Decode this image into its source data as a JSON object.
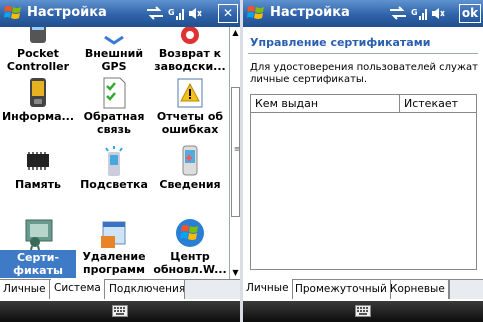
{
  "left": {
    "title": "Настройка",
    "close_button": "✕",
    "items": [
      {
        "label": "Pocket Controller",
        "icon": "pocket-controller-icon"
      },
      {
        "label": "Внешний GPS",
        "icon": "gps-icon"
      },
      {
        "label": "Возврат к заводски...",
        "icon": "factory-reset-icon"
      },
      {
        "label": "Информа...",
        "icon": "device-info-icon"
      },
      {
        "label": "Обратная связь",
        "icon": "feedback-icon"
      },
      {
        "label": "Отчеты об ошибках",
        "icon": "error-report-icon"
      },
      {
        "label": "Память",
        "icon": "memory-chip-icon"
      },
      {
        "label": "Подсветка",
        "icon": "backlight-icon"
      },
      {
        "label": "Сведения",
        "icon": "about-icon"
      },
      {
        "label": "Серти-фикаты",
        "icon": "certificates-icon",
        "selected": true
      },
      {
        "label": "Удаление программ",
        "icon": "remove-programs-icon"
      },
      {
        "label": "Центр обновл.W...",
        "icon": "windows-update-icon"
      }
    ],
    "tabs": [
      "Личные",
      "Система",
      "Подключения"
    ],
    "active_tab": "Система"
  },
  "right": {
    "title": "Настройка",
    "ok_button": "ok",
    "heading": "Управление сертификатами",
    "description": "Для удостоверения пользователей служат личные сертификаты.",
    "columns": [
      "Кем выдан",
      "Истекает"
    ],
    "rows": [],
    "tabs": [
      "Личные",
      "Промежуточный",
      "Корневые"
    ],
    "active_tab": "Личные"
  },
  "colors": {
    "titlebar": "#2f63a9",
    "accent": "#2a5fb0",
    "selection": "#3f7ac6",
    "softbar": "#1a1a1a"
  }
}
